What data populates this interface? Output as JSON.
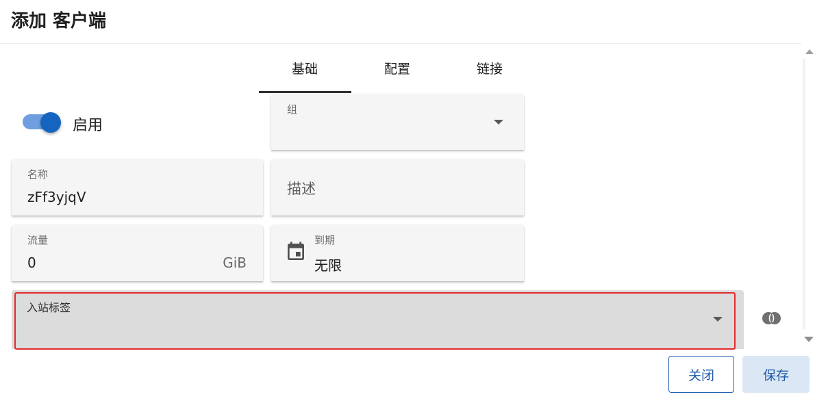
{
  "dialog": {
    "title": "添加 客户端"
  },
  "tabs": [
    {
      "label": "基础",
      "active": true
    },
    {
      "label": "配置",
      "active": false
    },
    {
      "label": "链接",
      "active": false
    }
  ],
  "form": {
    "enable": {
      "label": "启用",
      "checked": true
    },
    "group": {
      "label": "组",
      "value": ""
    },
    "name": {
      "label": "名称",
      "value": "zFf3yjqV"
    },
    "description": {
      "placeholder": "描述",
      "value": ""
    },
    "traffic": {
      "label": "流量",
      "value": "0",
      "unit": "GiB"
    },
    "expiry": {
      "label": "到期",
      "value": "无限",
      "icon": "calendar-icon"
    },
    "inbound_tags": {
      "label": "入站标签",
      "value": ""
    }
  },
  "actions": {
    "close_label": "关闭",
    "save_label": "保存"
  },
  "colors": {
    "accent": "#1565c0",
    "highlight_border": "#e12b2b"
  }
}
